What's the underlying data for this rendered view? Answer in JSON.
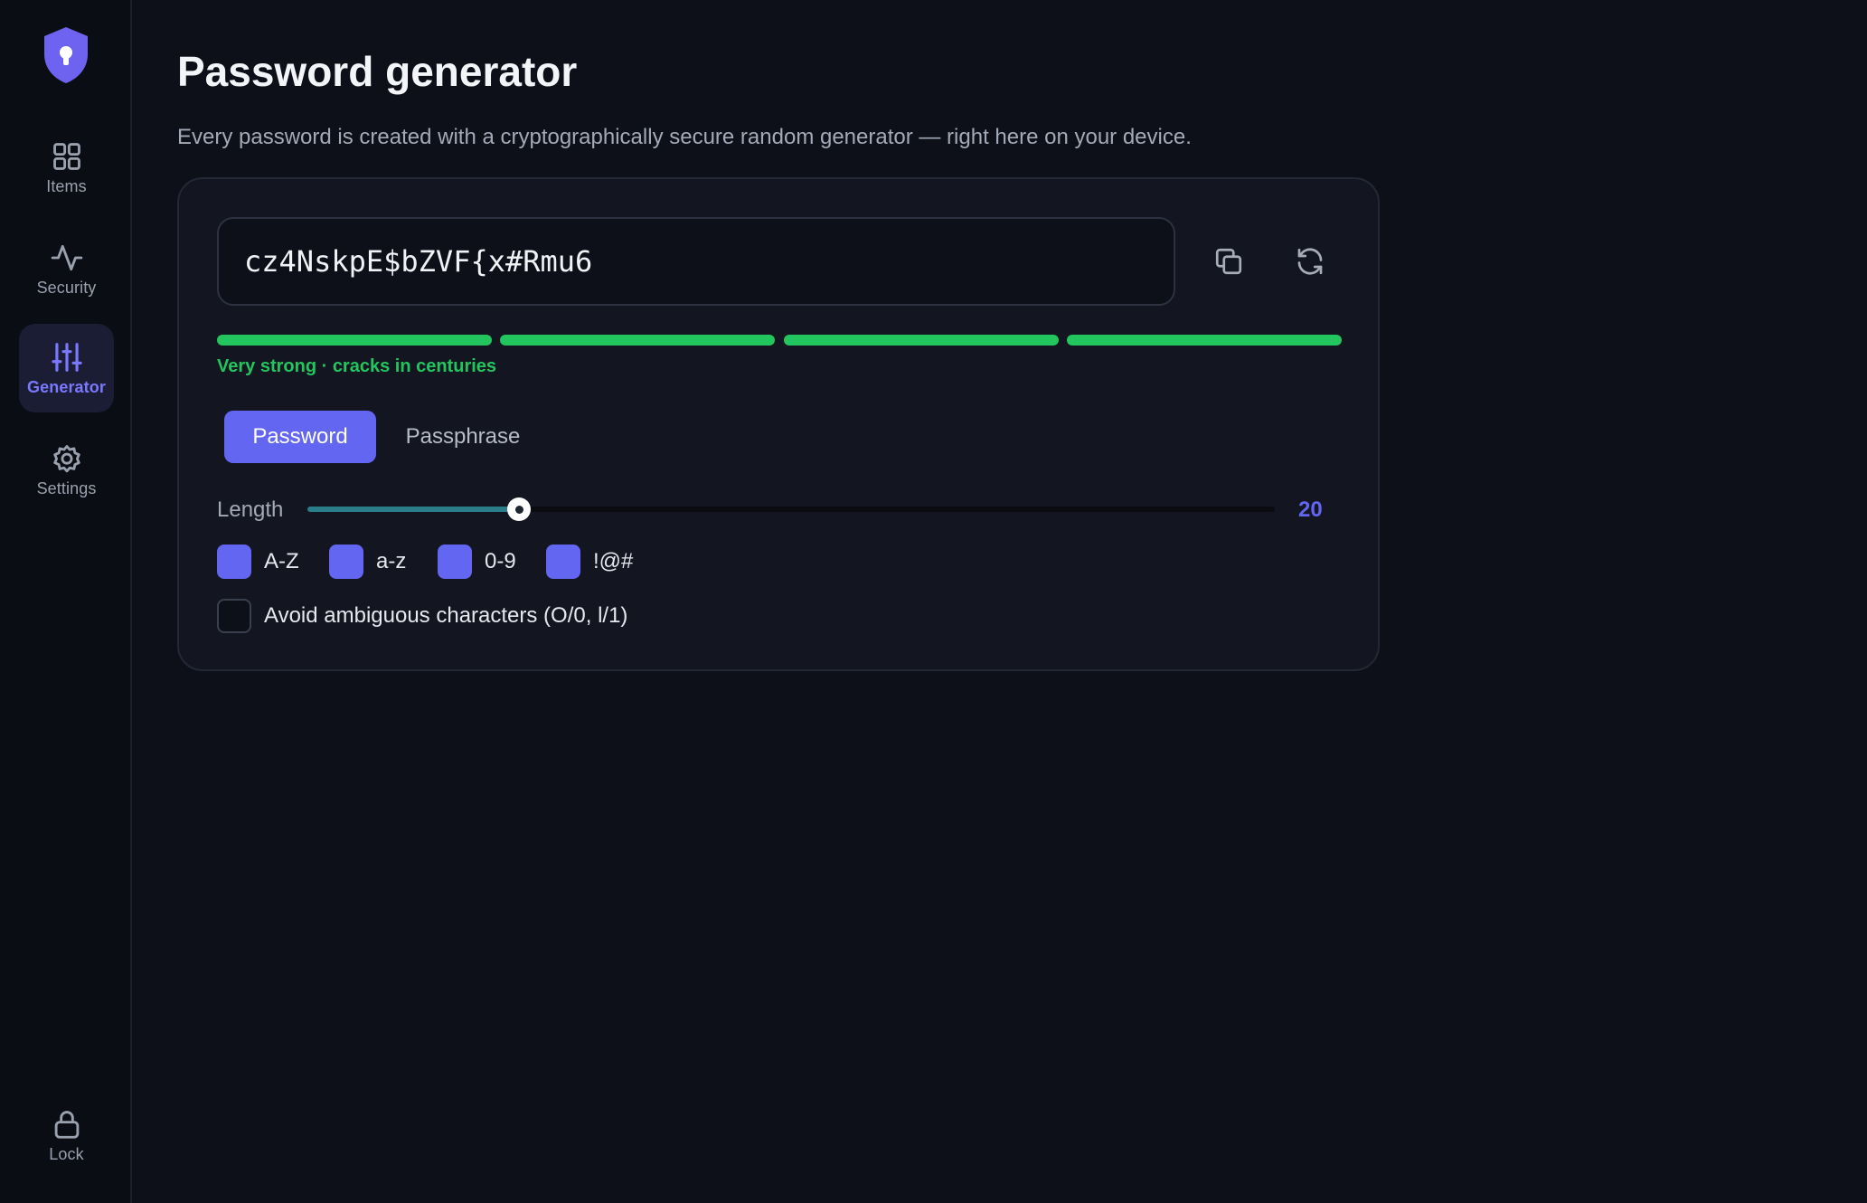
{
  "sidebar": {
    "logo_icon": "shield-keyhole-icon",
    "items": [
      {
        "label": "Items",
        "icon": "grid-icon",
        "active": false
      },
      {
        "label": "Security",
        "icon": "activity-icon",
        "active": false
      },
      {
        "label": "Generator",
        "icon": "sliders-icon",
        "active": true
      },
      {
        "label": "Settings",
        "icon": "gear-icon",
        "active": false
      }
    ],
    "lock": {
      "label": "Lock",
      "icon": "lock-icon"
    }
  },
  "page": {
    "title": "Password generator",
    "subtitle": "Every password is created with a cryptographically secure random generator — right here on your device."
  },
  "generator": {
    "password": "cz4NskpE$bZVF{x#Rmu6",
    "copy_icon": "copy-icon",
    "regenerate_icon": "refresh-icon",
    "strength": {
      "segments_total": 4,
      "segments_filled": 4,
      "label": "Very strong · cracks in centuries",
      "color": "#22c55e"
    },
    "modes": {
      "active": "Password",
      "inactive": "Passphrase"
    },
    "length": {
      "label": "Length",
      "value": "20",
      "slider_fraction": 0.219
    },
    "options": [
      {
        "label": "A-Z",
        "checked": true
      },
      {
        "label": "a-z",
        "checked": true
      },
      {
        "label": "0-9",
        "checked": true
      },
      {
        "label": "!@#",
        "checked": true
      }
    ],
    "avoid_ambiguous": {
      "label": "Avoid ambiguous characters (O/0, l/1)",
      "checked": false
    }
  },
  "colors": {
    "accent": "#6366f1",
    "strength_green": "#22c55e",
    "background": "#0d1019",
    "card": "#131620"
  }
}
